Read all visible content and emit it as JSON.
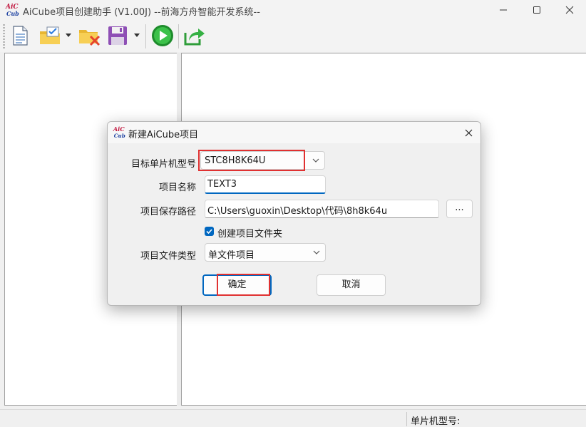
{
  "window": {
    "title": "AiCube项目创建助手 (V1.00J) --前海方舟智能开发系统--",
    "logo_text_top": "AiC",
    "logo_text_bottom": "Cube"
  },
  "toolbar": {
    "buttons": [
      "new-file-icon",
      "open-project-icon",
      "close-project-icon",
      "save-icon",
      "run-icon",
      "export-icon"
    ]
  },
  "statusbar": {
    "chip_model_label": "单片机型号:"
  },
  "dialog": {
    "title": "新建AiCube项目",
    "target_chip_label": "目标单片机型号",
    "target_chip_value": "STC8H8K64U",
    "project_name_label": "项目名称",
    "project_name_value": "TEXT3",
    "save_path_label": "项目保存路径",
    "save_path_value": "C:\\Users\\guoxin\\Desktop\\代码\\8h8k64u",
    "browse_label": "...",
    "create_folder_label": "创建项目文件夹",
    "create_folder_checked": true,
    "file_type_label": "项目文件类型",
    "file_type_value": "单文件项目",
    "ok_label": "确定",
    "cancel_label": "取消"
  },
  "colors": {
    "accent": "#0067c0",
    "highlight": "#e03131"
  }
}
